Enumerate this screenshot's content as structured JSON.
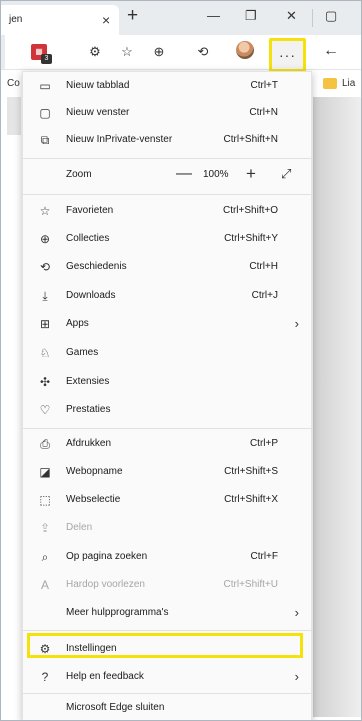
{
  "tab": {
    "title": "jen",
    "close": "×",
    "new_tab": "+"
  },
  "window": {
    "minimize": "—",
    "restore": "❐",
    "close": "✕",
    "sidebar": "▢"
  },
  "toolbar": {
    "ext_badge": "3",
    "more": "···",
    "back": "←"
  },
  "favbar": {
    "left": "Co",
    "right": "Lia"
  },
  "menu": {
    "items": [
      {
        "label": "Nieuw tabblad",
        "shortcut": "Ctrl+T",
        "icon": "new-tab-icon"
      },
      {
        "label": "Nieuw venster",
        "shortcut": "Ctrl+N",
        "icon": "new-window-icon"
      },
      {
        "label": "Nieuw InPrivate-venster",
        "shortcut": "Ctrl+Shift+N",
        "icon": "inprivate-icon"
      },
      {
        "label": "Zoom",
        "zoom_value": "100%",
        "icon": ""
      },
      {
        "label": "Favorieten",
        "shortcut": "Ctrl+Shift+O",
        "icon": "favorites-icon"
      },
      {
        "label": "Collecties",
        "shortcut": "Ctrl+Shift+Y",
        "icon": "collections-icon"
      },
      {
        "label": "Geschiedenis",
        "shortcut": "Ctrl+H",
        "icon": "history-icon"
      },
      {
        "label": "Downloads",
        "shortcut": "Ctrl+J",
        "icon": "download-icon"
      },
      {
        "label": "Apps",
        "shortcut": "",
        "icon": "apps-icon"
      },
      {
        "label": "Games",
        "shortcut": "",
        "icon": "games-icon"
      },
      {
        "label": "Extensies",
        "shortcut": "",
        "icon": "extensions-icon"
      },
      {
        "label": "Prestaties",
        "shortcut": "",
        "icon": "performance-icon"
      },
      {
        "label": "Afdrukken",
        "shortcut": "Ctrl+P",
        "icon": "print-icon"
      },
      {
        "label": "Webopname",
        "shortcut": "Ctrl+Shift+S",
        "icon": "web-capture-icon"
      },
      {
        "label": "Webselectie",
        "shortcut": "Ctrl+Shift+X",
        "icon": "web-select-icon"
      },
      {
        "label": "Delen",
        "shortcut": "",
        "icon": "share-icon"
      },
      {
        "label": "Op pagina zoeken",
        "shortcut": "Ctrl+F",
        "icon": "find-icon"
      },
      {
        "label": "Hardop voorlezen",
        "shortcut": "Ctrl+Shift+U",
        "icon": "read-aloud-icon"
      },
      {
        "label": "Meer hulpprogramma's",
        "shortcut": "",
        "icon": ""
      },
      {
        "label": "Instellingen",
        "shortcut": "",
        "icon": "settings-icon"
      },
      {
        "label": "Help en feedback",
        "shortcut": "",
        "icon": "help-icon"
      },
      {
        "label": "Microsoft Edge sluiten",
        "shortcut": "",
        "icon": ""
      }
    ]
  },
  "colors": {
    "highlight": "#f5e10b",
    "menu_bg": "#fafafa"
  }
}
